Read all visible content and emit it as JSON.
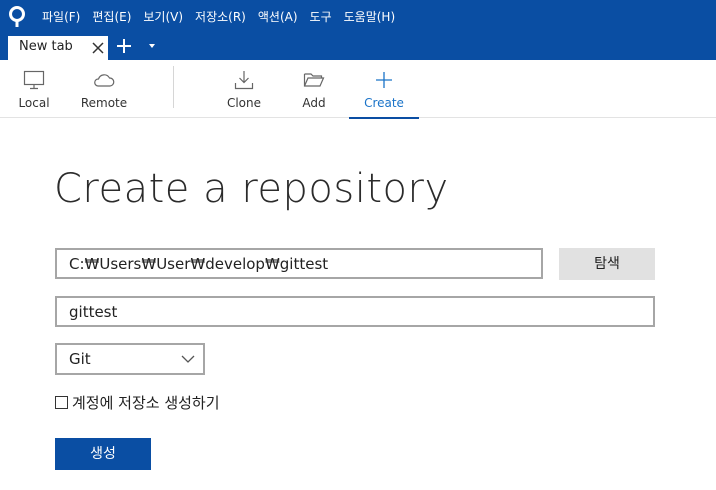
{
  "menu": {
    "items": [
      {
        "label": "파일(F)"
      },
      {
        "label": "편집(E)"
      },
      {
        "label": "보기(V)"
      },
      {
        "label": "저장소(R)"
      },
      {
        "label": "액션(A)"
      },
      {
        "label": "도구"
      },
      {
        "label": "도움말(H)"
      }
    ]
  },
  "tabs": {
    "active_label": "New tab"
  },
  "toolbar": {
    "local_label": "Local",
    "remote_label": "Remote",
    "clone_label": "Clone",
    "add_label": "Add",
    "create_label": "Create",
    "active": "create"
  },
  "main": {
    "title": "Create a repository",
    "path_value": "C:₩Users₩User₩develop₩gittest",
    "browse_label": "탐색",
    "name_value": "gittest",
    "vcs_selected": "Git",
    "checkbox_label": "계정에 저장소 생성하기",
    "checkbox_checked": false,
    "create_label": "생성"
  },
  "colors": {
    "accent": "#0a4ea3",
    "active_tab_text": "#1a73c8"
  },
  "icons": {
    "logo": "sourcetree-logo-icon",
    "close": "close-icon",
    "add": "plus-icon",
    "dropdown": "chevron-down-icon",
    "local": "monitor-icon",
    "remote": "cloud-icon",
    "clone": "download-icon",
    "add_repo": "folder-icon",
    "create": "plus-icon"
  }
}
